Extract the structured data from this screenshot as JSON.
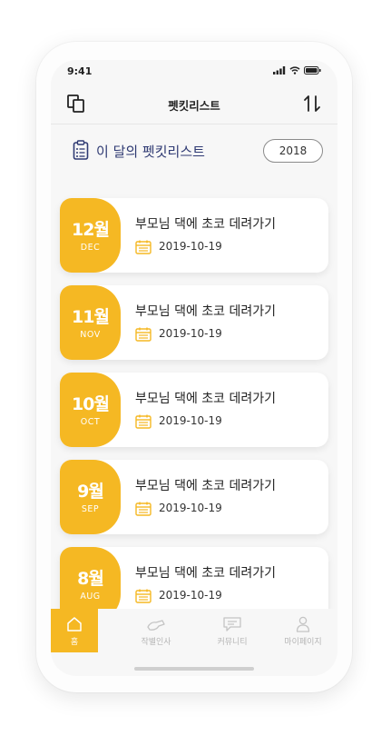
{
  "status_bar": {
    "time": "9:41"
  },
  "header": {
    "title": "펫킷리스트"
  },
  "section": {
    "title": "이 달의 펫킷리스트",
    "year": "2018"
  },
  "colors": {
    "accent": "#f5b823",
    "title_navy": "#2f3a73",
    "text": "#222222",
    "tab_inactive": "#b5b5b5"
  },
  "cards": [
    {
      "month": "12월",
      "abbr": "DEC",
      "title": "부모님 댁에 초코 데려가기",
      "date": "2019-10-19"
    },
    {
      "month": "11월",
      "abbr": "NOV",
      "title": "부모님 댁에 초코 데려가기",
      "date": "2019-10-19"
    },
    {
      "month": "10월",
      "abbr": "OCT",
      "title": "부모님 댁에 초코 데려가기",
      "date": "2019-10-19"
    },
    {
      "month": "9월",
      "abbr": "SEP",
      "title": "부모님 댁에 초코 데려가기",
      "date": "2019-10-19"
    },
    {
      "month": "8월",
      "abbr": "AUG",
      "title": "부모님 댁에 초코 데려가기",
      "date": "2019-10-19"
    }
  ],
  "tabs": [
    {
      "label": "홈",
      "icon": "home-icon",
      "active": true
    },
    {
      "label": "작별인사",
      "icon": "farewell-icon",
      "active": false
    },
    {
      "label": "커뮤니티",
      "icon": "chat-icon",
      "active": false
    },
    {
      "label": "마이페이지",
      "icon": "person-icon",
      "active": false
    }
  ]
}
